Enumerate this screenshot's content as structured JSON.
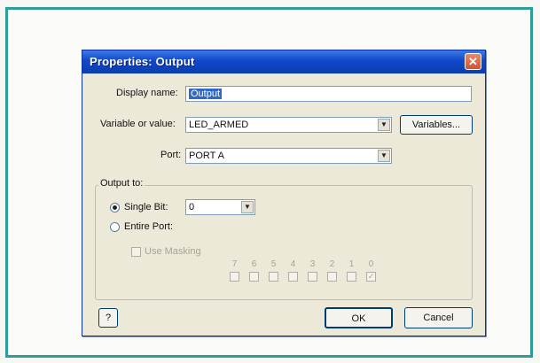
{
  "dialog": {
    "title": "Properties: Output",
    "close_symbol": "✕",
    "display_name_label": "Display name:",
    "display_name_value": "Output",
    "variable_label": "Variable or value:",
    "variable_value": "LED_ARMED",
    "variables_button": "Variables...",
    "port_label": "Port:",
    "port_value": "PORT A",
    "output_to_label": "Output to:",
    "single_bit_label": "Single Bit:",
    "single_bit_value": "0",
    "entire_port_label": "Entire Port:",
    "use_masking_label": "Use Masking",
    "bit_labels": [
      "7",
      "6",
      "5",
      "4",
      "3",
      "2",
      "1",
      "0"
    ],
    "bit_checked": [
      false,
      false,
      false,
      false,
      false,
      false,
      false,
      true
    ],
    "help_button": "?",
    "ok_button": "OK",
    "cancel_button": "Cancel",
    "selected_radio": "single-bit",
    "dropdown_arrow": "▼"
  },
  "colors": {
    "frame_border": "#2e9c98",
    "title_bar": "#1148c8",
    "dialog_bg": "#ece9d8",
    "selection": "#316ac5"
  }
}
